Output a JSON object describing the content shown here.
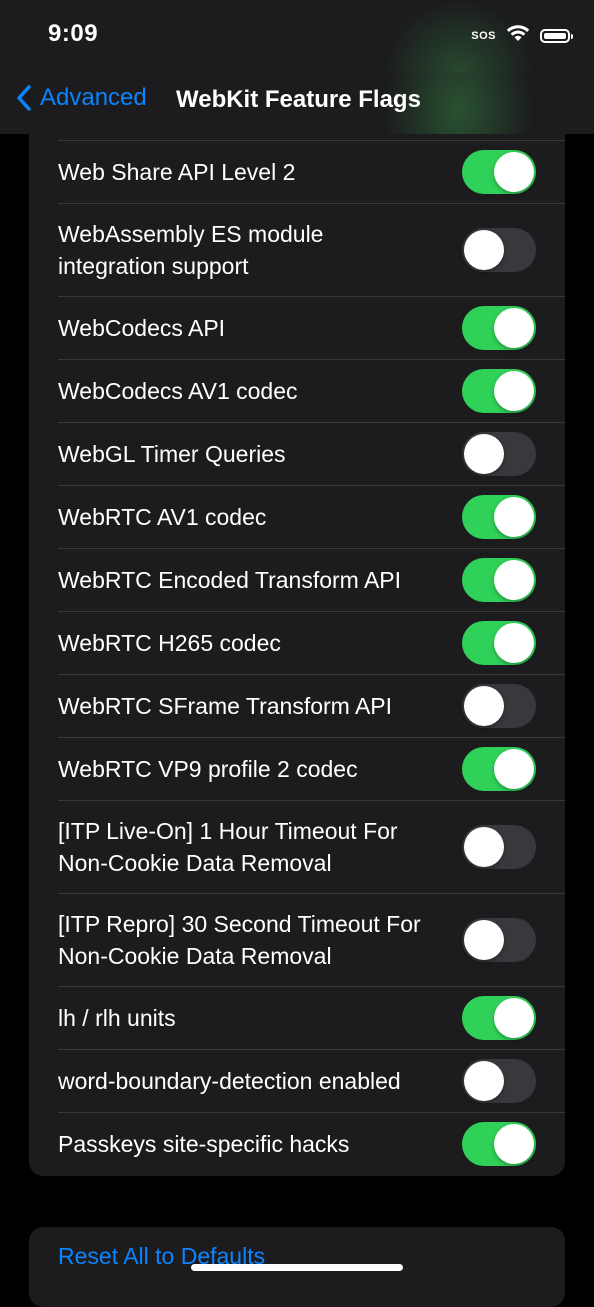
{
  "status_bar": {
    "time": "9:09",
    "sos": "SOS",
    "icons": [
      "signal-sos",
      "wifi-icon",
      "battery-icon"
    ]
  },
  "nav": {
    "back_label": "Advanced",
    "title": "WebKit Feature Flags"
  },
  "colors": {
    "accent": "#0a84ff",
    "toggle_on": "#30d158",
    "toggle_off": "#39393d",
    "cell_bg": "#1c1c1e"
  },
  "flags": [
    {
      "label": "Web Share API Level 2",
      "enabled": true
    },
    {
      "label": "WebAssembly ES module integration support",
      "enabled": false
    },
    {
      "label": "WebCodecs API",
      "enabled": true
    },
    {
      "label": "WebCodecs AV1 codec",
      "enabled": true
    },
    {
      "label": "WebGL Timer Queries",
      "enabled": false
    },
    {
      "label": "WebRTC AV1 codec",
      "enabled": true
    },
    {
      "label": "WebRTC Encoded Transform API",
      "enabled": true
    },
    {
      "label": "WebRTC H265 codec",
      "enabled": true
    },
    {
      "label": "WebRTC SFrame Transform API",
      "enabled": false
    },
    {
      "label": "WebRTC VP9 profile 2 codec",
      "enabled": true
    },
    {
      "label": "[ITP Live-On] 1 Hour Timeout For Non-Cookie Data Removal",
      "enabled": false
    },
    {
      "label": "[ITP Repro] 30 Second Timeout For Non-Cookie Data Removal",
      "enabled": false
    },
    {
      "label": "lh / rlh units",
      "enabled": true
    },
    {
      "label": "word-boundary-detection enabled",
      "enabled": false
    },
    {
      "label": "Passkeys site-specific hacks",
      "enabled": true
    }
  ],
  "reset": {
    "label": "Reset All to Defaults"
  }
}
